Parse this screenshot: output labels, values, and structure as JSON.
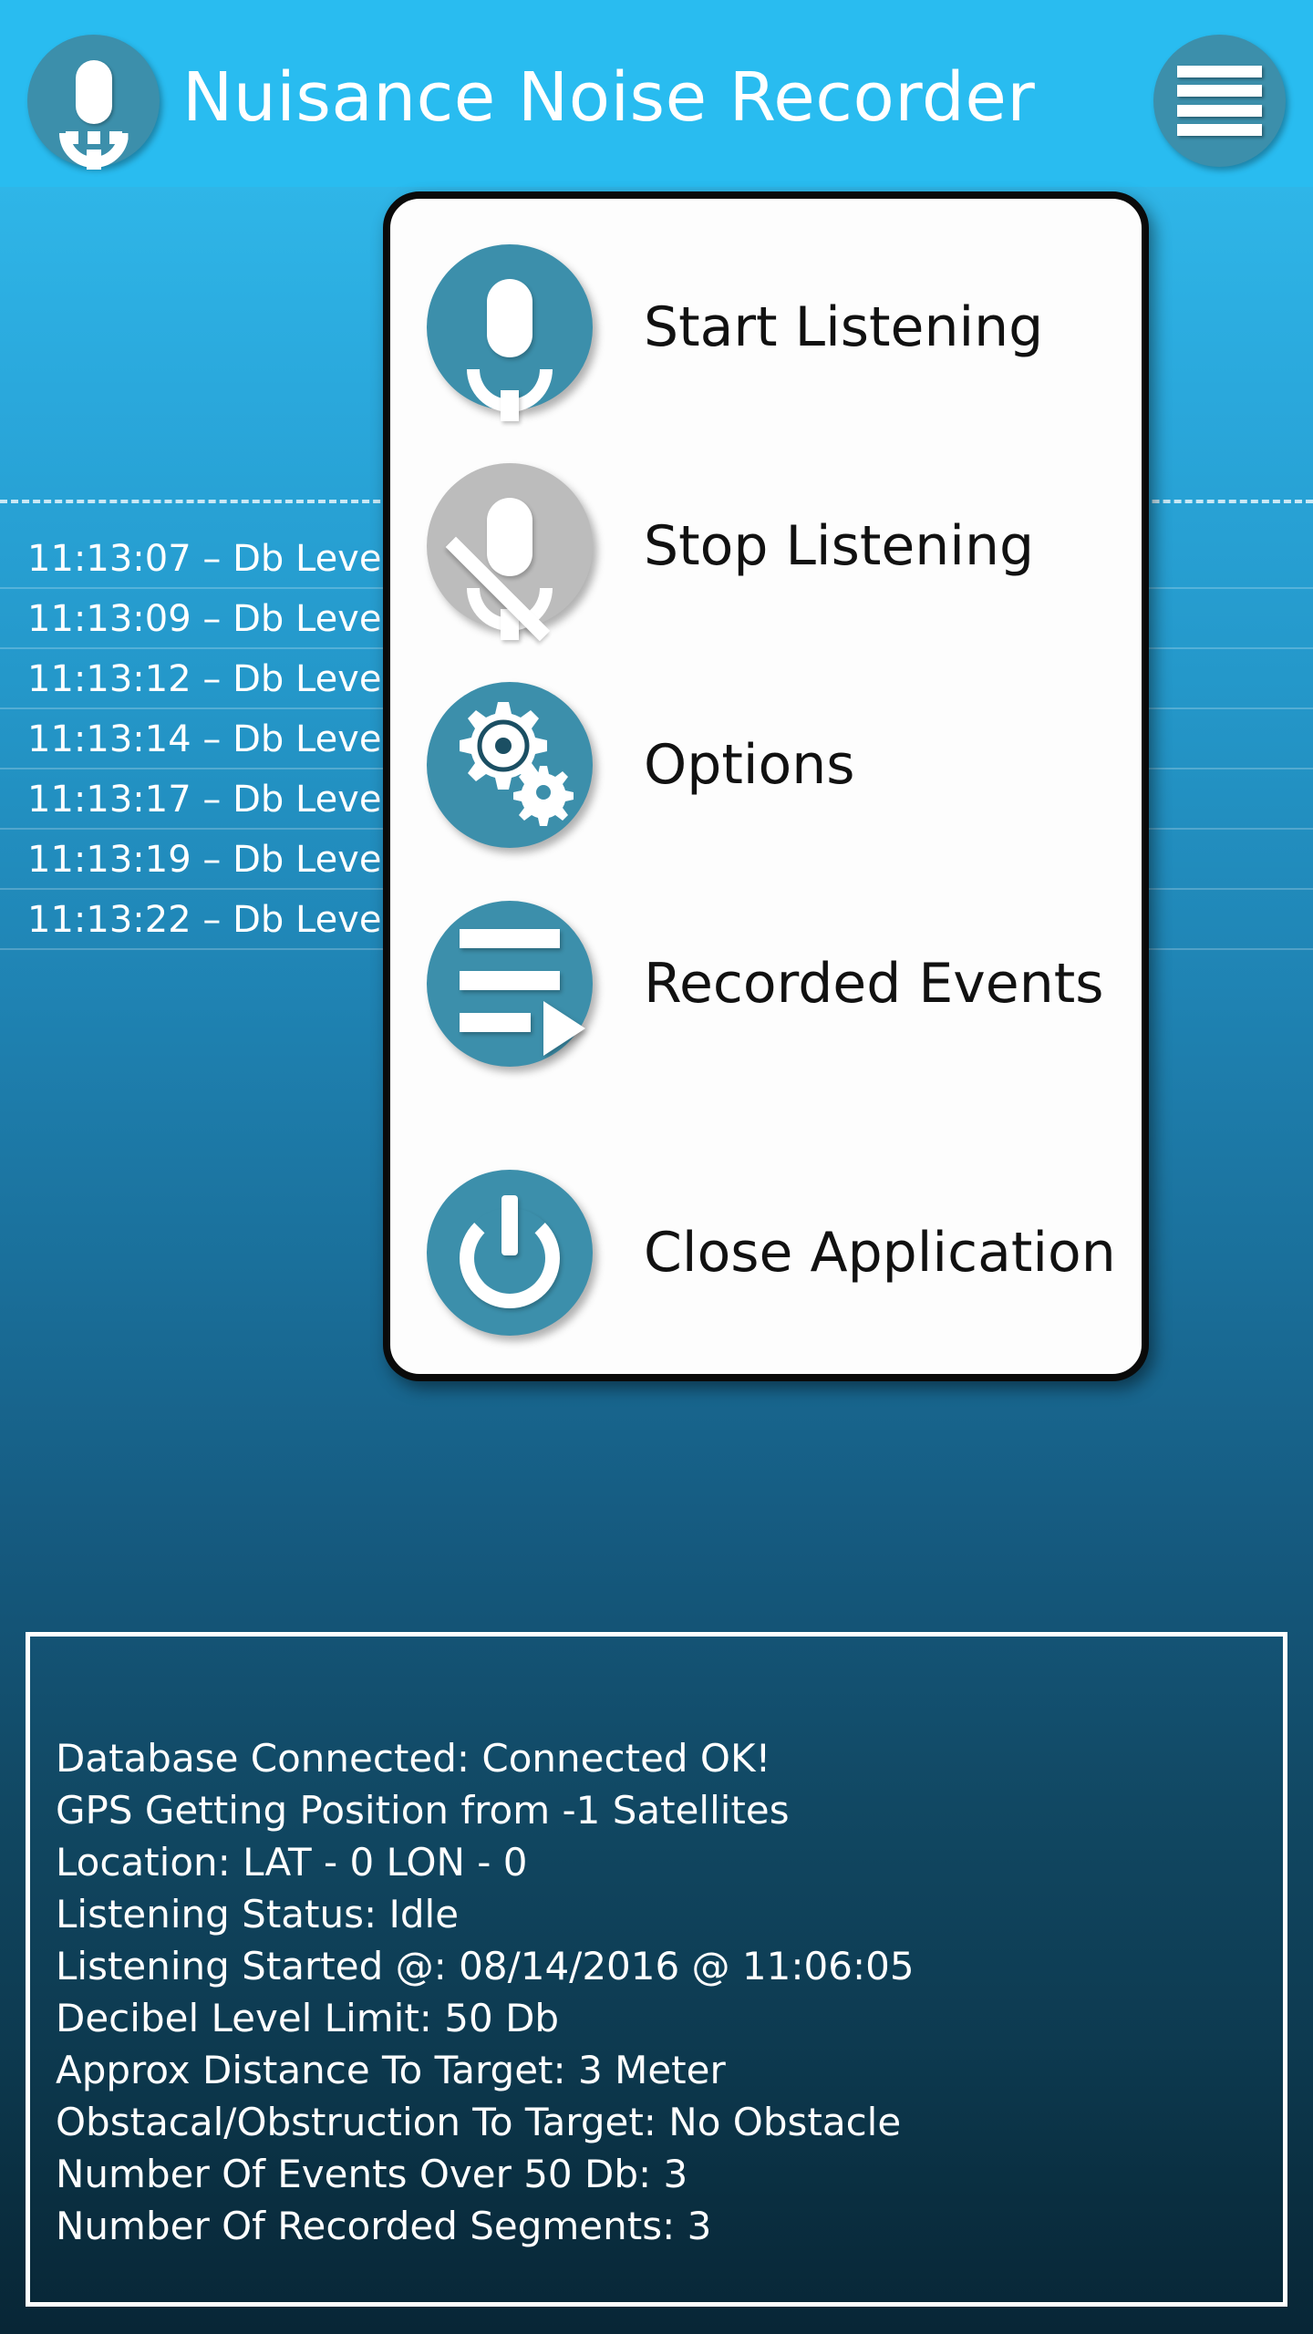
{
  "header": {
    "title": "Nuisance Noise Recorder",
    "mic_icon": "microphone-icon",
    "menu_icon": "hamburger-menu-icon",
    "bg_color": "#29bcf0",
    "icon_color": "#3c8fab"
  },
  "log": {
    "rows": [
      {
        "text": "11:13:07 – Db Leve"
      },
      {
        "text": "11:13:09 – Db Leve"
      },
      {
        "text": "11:13:12 – Db Leve"
      },
      {
        "text": "11:13:14 – Db Leve"
      },
      {
        "text": "11:13:17 – Db Leve"
      },
      {
        "text": "11:13:19 – Db Leve"
      },
      {
        "text": "11:13:22 – Db Leve"
      }
    ]
  },
  "dialog": {
    "items": [
      {
        "label": "Start Listening",
        "icon": "microphone-icon",
        "state": "enabled"
      },
      {
        "label": "Stop Listening",
        "icon": "microphone-muted-icon",
        "state": "disabled"
      },
      {
        "label": "Options",
        "icon": "gear-icon",
        "state": "enabled"
      },
      {
        "label": "Recorded Events",
        "icon": "list-play-icon",
        "state": "enabled"
      },
      {
        "label": "Close Application",
        "icon": "power-icon",
        "state": "enabled"
      }
    ]
  },
  "status": {
    "lines": [
      "Database Connected: Connected OK!",
      "GPS Getting Position from -1 Satellites",
      "Location: LAT - 0 LON - 0",
      "Listening Status: Idle",
      "Listening Started @: 08/14/2016 @ 11:06:05",
      "Decibel Level Limit: 50 Db",
      "Approx Distance To Target: 3 Meter",
      "Obstacal/Obstruction To Target: No Obstacle",
      "Number Of Events Over 50 Db: 3",
      "Number Of Recorded Segments: 3"
    ]
  }
}
